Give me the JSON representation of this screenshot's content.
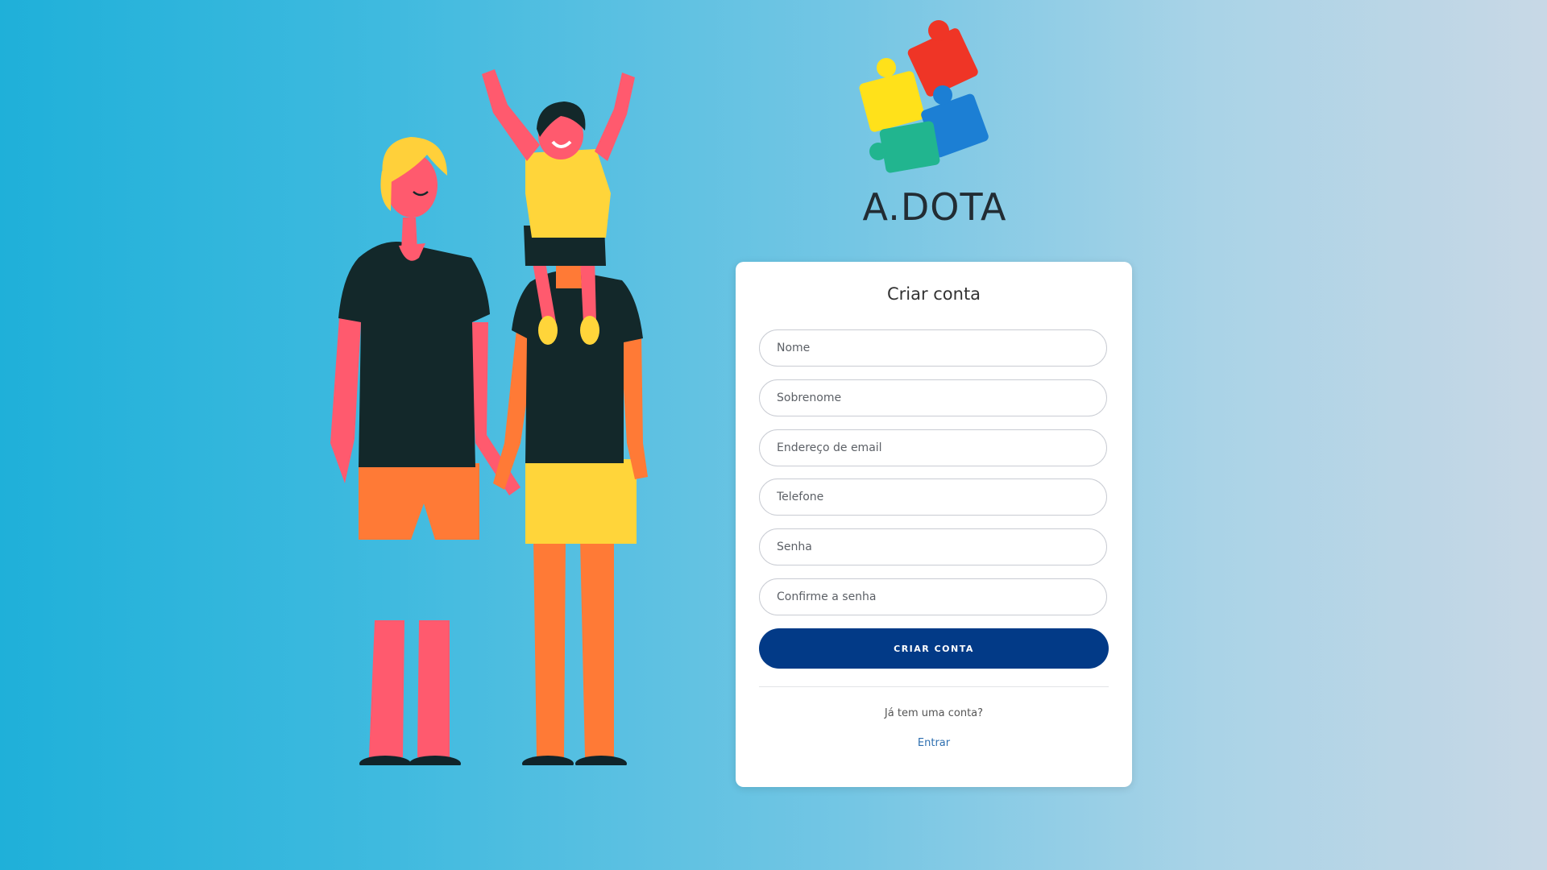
{
  "brand": {
    "name": "A.DOTA"
  },
  "form": {
    "title": "Criar conta",
    "fields": [
      {
        "placeholder": "Nome",
        "value": ""
      },
      {
        "placeholder": "Sobrenome",
        "value": ""
      },
      {
        "placeholder": "Endereço de email",
        "value": ""
      },
      {
        "placeholder": "Telefone",
        "value": ""
      },
      {
        "placeholder": "Senha",
        "value": ""
      },
      {
        "placeholder": "Confirme a senha",
        "value": ""
      }
    ],
    "submit_label": "CRIAR CONTA",
    "login_prompt": "Já tem uma conta?",
    "login_link": "Entrar"
  },
  "colors": {
    "primary_button": "#023a87",
    "link": "#2e6fb0",
    "background_start": "#1fb0d9",
    "background_end": "#c8d8e6"
  },
  "icons": [
    "family-illustration",
    "puzzle-logo-icon"
  ]
}
